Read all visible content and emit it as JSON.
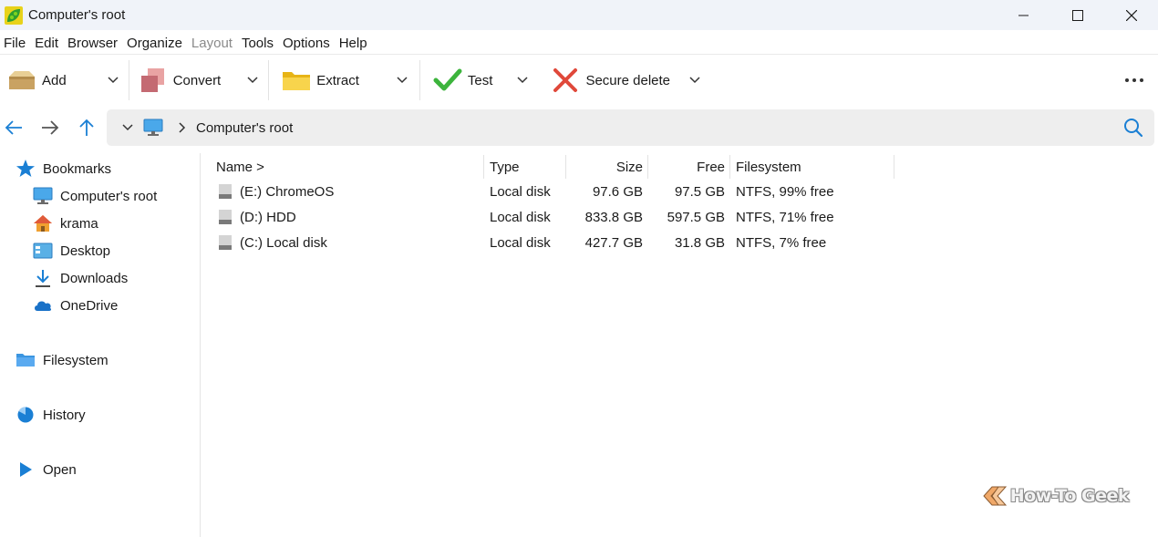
{
  "window": {
    "title": "Computer's root"
  },
  "menu": {
    "items": [
      "File",
      "Edit",
      "Browser",
      "Organize",
      "Layout",
      "Tools",
      "Options",
      "Help"
    ]
  },
  "toolbar": {
    "add_label": "Add",
    "convert_label": "Convert",
    "extract_label": "Extract",
    "test_label": "Test",
    "secure_delete_label": "Secure delete"
  },
  "address": {
    "path": "Computer's root"
  },
  "sidebar": {
    "bookmarks_label": "Bookmarks",
    "items": [
      {
        "label": "Computer's root",
        "icon": "monitor-icon"
      },
      {
        "label": "krama",
        "icon": "home-icon"
      },
      {
        "label": "Desktop",
        "icon": "desktop-icon"
      },
      {
        "label": "Downloads",
        "icon": "download-icon"
      },
      {
        "label": "OneDrive",
        "icon": "cloud-icon"
      }
    ],
    "filesystem_label": "Filesystem",
    "history_label": "History",
    "open_label": "Open"
  },
  "filelist": {
    "columns": {
      "name": "Name >",
      "type": "Type",
      "size": "Size",
      "free": "Free",
      "filesystem": "Filesystem"
    },
    "rows": [
      {
        "name": "(E:) ChromeOS",
        "type": "Local disk",
        "size": "97.6 GB",
        "free": "97.5 GB",
        "filesystem": "NTFS, 99% free"
      },
      {
        "name": "(D:) HDD",
        "type": "Local disk",
        "size": "833.8 GB",
        "free": "597.5 GB",
        "filesystem": "NTFS, 71% free"
      },
      {
        "name": "(C:) Local disk",
        "type": "Local disk",
        "size": "427.7 GB",
        "free": "31.8 GB",
        "filesystem": "NTFS, 7% free"
      }
    ]
  },
  "watermark": {
    "text": "How-To Geek"
  },
  "colors": {
    "accent_blue": "#1a7fd4",
    "test_green": "#3cb43c",
    "delete_red": "#e0483a",
    "folder_yellow": "#f5c518"
  }
}
